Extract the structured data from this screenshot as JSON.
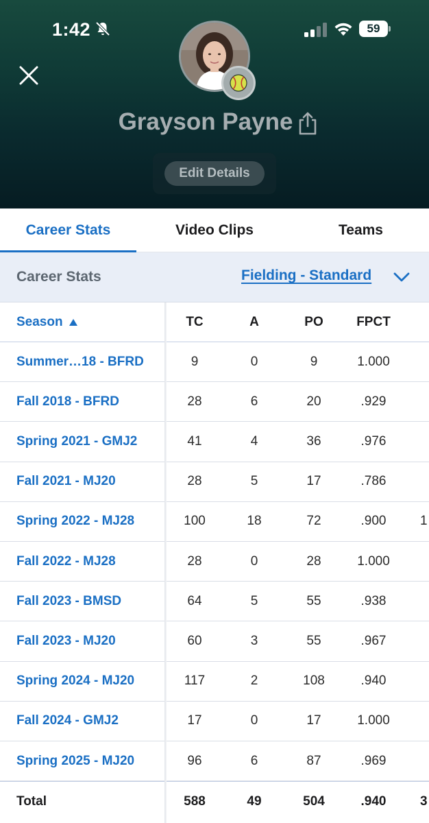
{
  "status_bar": {
    "time": "1:42",
    "battery": "59"
  },
  "profile": {
    "name": "Grayson Payne",
    "edit_label": "Edit Details"
  },
  "tabs": [
    {
      "label": "Career Stats",
      "active": true
    },
    {
      "label": "Video Clips",
      "active": false
    },
    {
      "label": "Teams",
      "active": false
    }
  ],
  "filter": {
    "label": "Career Stats",
    "selected": "Fielding - Standard"
  },
  "table": {
    "columns": [
      "Season",
      "TC",
      "A",
      "PO",
      "FPCT"
    ],
    "rows": [
      {
        "season": "Summer…18 - BFRD",
        "tc": "9",
        "a": "0",
        "po": "9",
        "fpct": "1.000"
      },
      {
        "season": "Fall 2018 - BFRD",
        "tc": "28",
        "a": "6",
        "po": "20",
        "fpct": ".929"
      },
      {
        "season": "Spring 2021 - GMJ2",
        "tc": "41",
        "a": "4",
        "po": "36",
        "fpct": ".976"
      },
      {
        "season": "Fall 2021 - MJ20",
        "tc": "28",
        "a": "5",
        "po": "17",
        "fpct": ".786"
      },
      {
        "season": "Spring 2022 - MJ28",
        "tc": "100",
        "a": "18",
        "po": "72",
        "fpct": ".900",
        "extra": "1"
      },
      {
        "season": "Fall 2022 - MJ28",
        "tc": "28",
        "a": "0",
        "po": "28",
        "fpct": "1.000"
      },
      {
        "season": "Fall 2023 - BMSD",
        "tc": "64",
        "a": "5",
        "po": "55",
        "fpct": ".938"
      },
      {
        "season": "Fall 2023 - MJ20",
        "tc": "60",
        "a": "3",
        "po": "55",
        "fpct": ".967"
      },
      {
        "season": "Spring 2024 - MJ20",
        "tc": "117",
        "a": "2",
        "po": "108",
        "fpct": ".940"
      },
      {
        "season": "Fall 2024 - GMJ2",
        "tc": "17",
        "a": "0",
        "po": "17",
        "fpct": "1.000"
      },
      {
        "season": "Spring 2025 - MJ20",
        "tc": "96",
        "a": "6",
        "po": "87",
        "fpct": ".969"
      }
    ],
    "total": {
      "season": "Total",
      "tc": "588",
      "a": "49",
      "po": "504",
      "fpct": ".940",
      "extra": "3"
    }
  },
  "icons": {
    "close": "close-icon",
    "share": "share-icon",
    "chevron": "chevron-down-icon",
    "sort": "sort-ascending-icon",
    "sport": "softball-icon",
    "bell": "bell-slash-icon"
  },
  "colors": {
    "accent": "#1a6fc4",
    "header_top": "#184a3e",
    "header_bottom": "#061c22",
    "filter_bg": "#e9eef7",
    "badge": "#d6e24a"
  }
}
